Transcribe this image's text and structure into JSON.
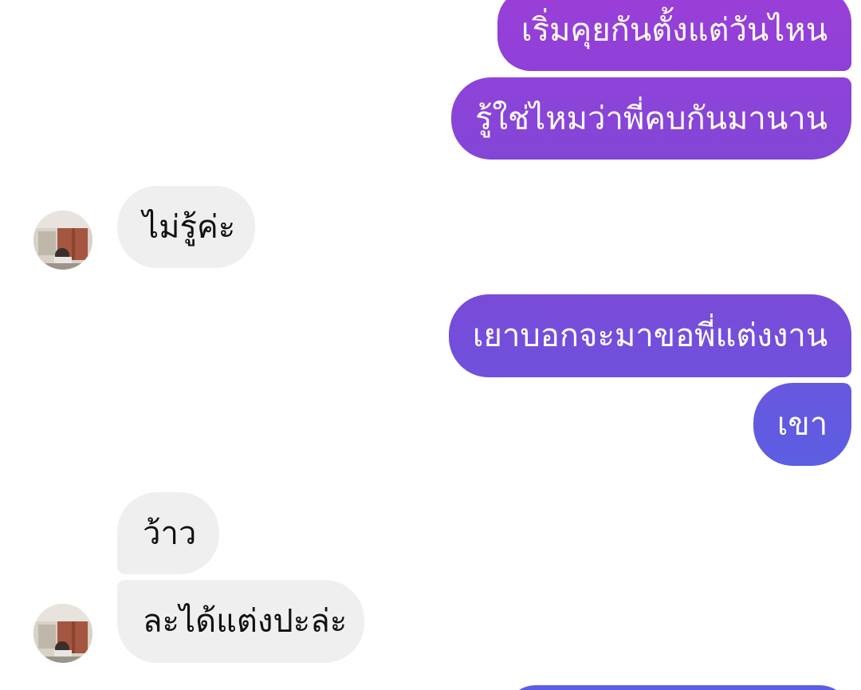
{
  "messages": [
    {
      "side": "sent",
      "text": "เริ่มคุยกันตั้งแต่วันไหน"
    },
    {
      "side": "sent",
      "text": "รู้ใช่ไหมว่าพี่คบกันมานาน"
    },
    {
      "side": "received",
      "text": "ไม่รู้ค่ะ"
    },
    {
      "side": "sent",
      "text": "เยาบอกจะมาขอพี่แต่งงาน"
    },
    {
      "side": "sent",
      "text": "เขา"
    },
    {
      "side": "received",
      "text": "ว้าว"
    },
    {
      "side": "received",
      "text": "ละได้แต่งปะล่ะ"
    }
  ],
  "colors": {
    "sent_gradient_top": "#9a3fd8",
    "sent_gradient_bottom": "#5c5de3",
    "received_bubble": "#efefef",
    "background": "#ffffff"
  },
  "icons": {
    "avatar": "contact-avatar-photo"
  }
}
